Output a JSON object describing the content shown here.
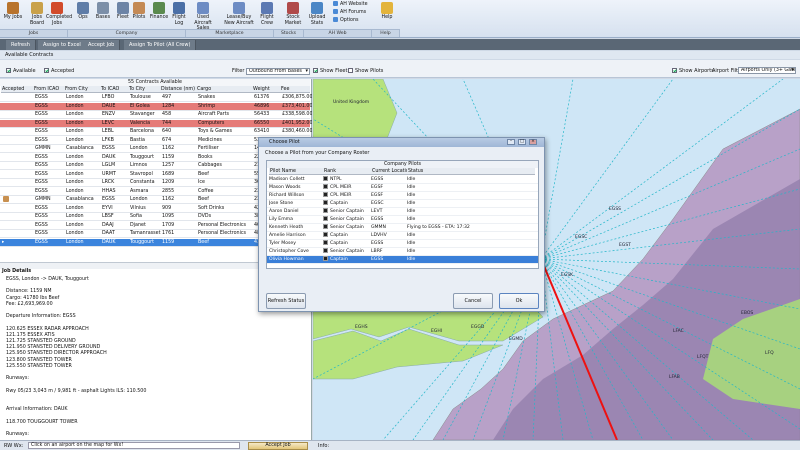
{
  "ribbon": {
    "buttons": [
      {
        "label": "My Jobs",
        "icon": "briefcase-icon",
        "color": "#b8732c"
      },
      {
        "label": "Jobs Board",
        "icon": "clipboard-icon",
        "color": "#c9a14a"
      },
      {
        "label": "Completed Jobs",
        "icon": "check-icon",
        "color": "#d24b2b"
      },
      {
        "label": "Ops",
        "icon": "gear-icon",
        "color": "#5f7da8"
      },
      {
        "label": "Bases",
        "icon": "base-icon",
        "color": "#7c8fa8"
      },
      {
        "label": "Fleet",
        "icon": "plane-icon",
        "color": "#6c84a6"
      },
      {
        "label": "Pilots",
        "icon": "pilot-icon",
        "color": "#c48a55"
      },
      {
        "label": "Finance",
        "icon": "finance-icon",
        "color": "#5a8a4e"
      },
      {
        "label": "Flight Log",
        "icon": "log-icon",
        "color": "#4a6fa6"
      },
      {
        "label": "Used Aircraft Sales",
        "icon": "used-aircraft-icon",
        "color": "#6d8cc4"
      },
      {
        "label": "Lease/Buy New Aircraft",
        "icon": "new-aircraft-icon",
        "color": "#6d8cc4"
      },
      {
        "label": "Flight Crew",
        "icon": "crew-icon",
        "color": "#5b79b3"
      },
      {
        "label": "Stock Market",
        "icon": "stock-icon",
        "color": "#b04a4a"
      },
      {
        "label": "Upload Stats",
        "icon": "upload-icon",
        "color": "#4a86c6"
      },
      {
        "label": "Help",
        "icon": "help-icon",
        "color": "#e3b43c"
      }
    ],
    "web_links": [
      "AH Website",
      "AH Forums",
      "Options"
    ],
    "groups": [
      "Jobs",
      "Company",
      "Marketplace",
      "Stocks",
      "AH Web",
      "Help"
    ]
  },
  "tabs": [
    "Refresh",
    "Assign to Excel",
    "Accept Job",
    "Assign To Pilot (All Crew)"
  ],
  "page_title": "Available Contracts",
  "filters": {
    "available": "Available",
    "accepted": "Accepted",
    "filter_label": "Filter",
    "filter_value": "Outbound From Bases",
    "show_fleet": "Show Fleet",
    "show_pilots": "Show Pilots",
    "show_airports": "Show Airports",
    "airport_filter_label": "Airport Filter",
    "airport_filter_value": "Airports Only (3+ Gates)"
  },
  "contracts": {
    "count_label": "55 Contracts Available",
    "columns": [
      "Accepted",
      "From ICAO",
      "From City",
      "To ICAO",
      "To City",
      "Distance (nm)",
      "Cargo",
      "Weight",
      "Fee"
    ],
    "rows": [
      {
        "from": "EGSS",
        "from_city": "London",
        "to": "LFBO",
        "to_city": "Toulouse",
        "dist": "497",
        "cargo": "Snakes",
        "weight": "61376",
        "fee": "£306,875.00",
        "style": ""
      },
      {
        "from": "EGSS",
        "from_city": "London",
        "to": "DAUE",
        "to_city": "El Golea",
        "dist": "1284",
        "cargo": "Shrimp",
        "weight": "46896",
        "fee": "£373,401.00",
        "style": "red"
      },
      {
        "from": "EGSS",
        "from_city": "London",
        "to": "ENZV",
        "to_city": "Stavanger",
        "dist": "458",
        "cargo": "Aircraft Parts",
        "weight": "56433",
        "fee": "£338,598.00",
        "style": ""
      },
      {
        "from": "EGSS",
        "from_city": "London",
        "to": "LEVC",
        "to_city": "Valencia",
        "dist": "744",
        "cargo": "Computers",
        "weight": "66550",
        "fee": "£401,952.00",
        "style": "red"
      },
      {
        "from": "EGSS",
        "from_city": "London",
        "to": "LEBL",
        "to_city": "Barcelona",
        "dist": "640",
        "cargo": "Toys & Games",
        "weight": "63410",
        "fee": "£380,460.00",
        "style": ""
      },
      {
        "from": "EGSS",
        "from_city": "London",
        "to": "LFKB",
        "to_city": "Bastia",
        "dist": "674",
        "cargo": "Medicines",
        "weight": "53637",
        "fee": "",
        "style": ""
      },
      {
        "from": "GMMN",
        "from_city": "Casablanca",
        "to": "EGSS",
        "to_city": "London",
        "dist": "1162",
        "cargo": "Fertiliser",
        "weight": "14171",
        "fee": "",
        "style": ""
      },
      {
        "from": "EGSS",
        "from_city": "London",
        "to": "DAUK",
        "to_city": "Touggourt",
        "dist": "1159",
        "cargo": "Books",
        "weight": "22223",
        "fee": "",
        "style": ""
      },
      {
        "from": "EGSS",
        "from_city": "London",
        "to": "LGLM",
        "to_city": "Limnos",
        "dist": "1257",
        "cargo": "Cabbages",
        "weight": "21660",
        "fee": "",
        "style": ""
      },
      {
        "from": "EGSS",
        "from_city": "London",
        "to": "URMT",
        "to_city": "Stavropol",
        "dist": "1689",
        "cargo": "Beef",
        "weight": "55829",
        "fee": "",
        "style": ""
      },
      {
        "from": "EGSS",
        "from_city": "London",
        "to": "LRCK",
        "to_city": "Constanta",
        "dist": "1209",
        "cargo": "Ice",
        "weight": "36298",
        "fee": "",
        "style": ""
      },
      {
        "from": "EGSS",
        "from_city": "London",
        "to": "HHAS",
        "to_city": "Asmara",
        "dist": "2855",
        "cargo": "Coffee",
        "weight": "23958",
        "fee": "",
        "style": ""
      },
      {
        "from": "GMMN",
        "from_city": "Casablanca",
        "to": "EGSS",
        "to_city": "London",
        "dist": "1162",
        "cargo": "Beef",
        "weight": "23112",
        "fee": "",
        "style": "pilot"
      },
      {
        "from": "EGSS",
        "from_city": "London",
        "to": "EYVI",
        "to_city": "Vilnius",
        "dist": "909",
        "cargo": "Soft Drinks",
        "weight": "42956",
        "fee": "",
        "style": ""
      },
      {
        "from": "EGSS",
        "from_city": "London",
        "to": "LBSF",
        "to_city": "Sofia",
        "dist": "1095",
        "cargo": "DVDs",
        "weight": "38356",
        "fee": "",
        "style": ""
      },
      {
        "from": "EGSS",
        "from_city": "London",
        "to": "DAAJ",
        "to_city": "Djanet",
        "dist": "1709",
        "cargo": "Personal Electronics",
        "weight": "46700",
        "fee": "",
        "style": ""
      },
      {
        "from": "EGSS",
        "from_city": "London",
        "to": "DAAT",
        "to_city": "Tamanrasset",
        "dist": "1761",
        "cargo": "Personal Electronics",
        "weight": "48287",
        "fee": "",
        "style": ""
      },
      {
        "from": "EGSS",
        "from_city": "London",
        "to": "DAUK",
        "to_city": "Touggourt",
        "dist": "1159",
        "cargo": "Beef",
        "weight": "41287",
        "fee": "",
        "style": "blue"
      }
    ]
  },
  "job_details": {
    "header": "Job Details",
    "lines": [
      "EGSS, London -> DAUK, Touggourt",
      "",
      "Distance:          1159 NM",
      "Cargo:              41780 lbs Beef",
      "Fee:                 £2,693,969.00",
      "",
      "Departure Information: EGSS",
      "",
      "120.625   ESSEX RADAR APPROACH",
      "121.175   ESSEX ATIS",
      "121.725   STANSTED GROUND",
      "121.950   STANSTED DELIVERY GROUND",
      "125.950   STANSTED DIRECTOR APPROACH",
      "123.800   STANSTED TOWER",
      "125.550   STANSTED TOWER",
      "",
      "Runways:",
      "",
      "Rwy 05/23        3,043 m / 9,981 ft - asphalt    Lights    ILS: 110.500",
      "",
      "",
      "Arrival Information: DAUK",
      "",
      "118.700   TOUGGOURT TOWER",
      "",
      "Runways:"
    ]
  },
  "status_bar": {
    "label": "RW Wx:",
    "hint": "Click on an airport on the map for Wx!",
    "accept_button": "Accept Job",
    "info_label": "Info:"
  },
  "map_labels": {
    "country": "United Kingdom",
    "airports": [
      "EGMM",
      "EGSS",
      "EGST",
      "EGSC",
      "EGHS",
      "EGHI",
      "EGGD",
      "EGMD",
      "EBOS",
      "LFAC",
      "LFQT",
      "LFAB",
      "LFQ",
      "EGNM",
      "EGSK"
    ]
  },
  "dialog": {
    "title": "Choose Pilot",
    "subtitle": "Choose a Pilot from your Company Roster",
    "table_title": "Company Pilots",
    "columns": [
      "Pilot Name",
      "Rank",
      "Current Location",
      "Status"
    ],
    "pilots": [
      {
        "name": "Madison Collett",
        "rank": "NTPL",
        "loc": "EGSS",
        "status": "Idle"
      },
      {
        "name": "Mason Woods",
        "rank": "CPL MEIR",
        "loc": "EGSF",
        "status": "Idle"
      },
      {
        "name": "Richard Willson",
        "rank": "CPL MEIR",
        "loc": "EGSF",
        "status": "Idle"
      },
      {
        "name": "Jose Stone",
        "rank": "Captain",
        "loc": "EGSC",
        "status": "Idle"
      },
      {
        "name": "Aaron Daniel",
        "rank": "Senior Captain",
        "loc": "LEVT",
        "status": "Idle"
      },
      {
        "name": "Lily Emma",
        "rank": "Senior Captain",
        "loc": "EGSS",
        "status": "Idle"
      },
      {
        "name": "Kenneth Heath",
        "rank": "Senior Captain",
        "loc": "GMMN",
        "status": "Flying to EGSS - ETA: 17:32"
      },
      {
        "name": "Amelie Harrison",
        "rank": "Captain",
        "loc": "LDVHV",
        "status": "Idle"
      },
      {
        "name": "Tyler Mosey",
        "rank": "Captain",
        "loc": "EGSS",
        "status": "Idle"
      },
      {
        "name": "Christopher Cove",
        "rank": "Senior Captain",
        "loc": "LBRF",
        "status": "Idle"
      },
      {
        "name": "Olivia Howman",
        "rank": "Captain",
        "loc": "EGSS",
        "status": "Idle"
      }
    ],
    "refresh_button": "Refresh Status",
    "cancel_button": "Cancel",
    "ok_button": "Ok"
  }
}
